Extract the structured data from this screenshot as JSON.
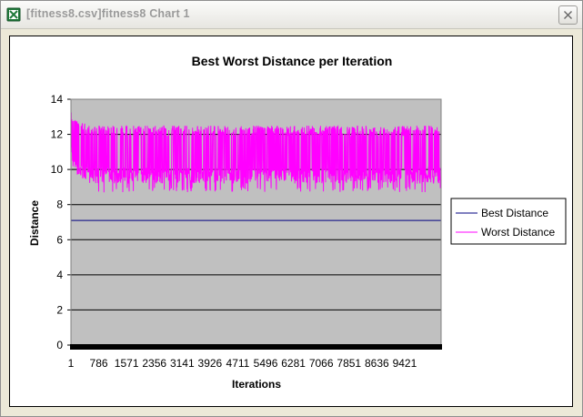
{
  "window": {
    "title": "[fitness8.csv]fitness8 Chart 1",
    "app_icon": "excel-chart-icon",
    "close_icon": "close-icon"
  },
  "chart_data": {
    "type": "line",
    "title": "Best Worst Distance per Iteration",
    "xlabel": "Iterations",
    "ylabel": "Distance",
    "ylim": [
      0,
      14
    ],
    "xlim": [
      1,
      10450
    ],
    "y_ticks": [
      0,
      2,
      4,
      6,
      8,
      10,
      12,
      14
    ],
    "x_tick_labels": [
      "1",
      "786",
      "1571",
      "2356",
      "3141",
      "3926",
      "4711",
      "5496",
      "6281",
      "7066",
      "7851",
      "8636",
      "9421"
    ],
    "grid": true,
    "legend": "right",
    "plot_background": "#c0c0c0",
    "series": [
      {
        "name": "Best Distance",
        "color": "#000080",
        "x": [
          1,
          10450
        ],
        "values": [
          7.1,
          7.1
        ]
      },
      {
        "name": "Worst Distance",
        "color": "#ff00ff",
        "band": true,
        "x": [
          1,
          50,
          100,
          200,
          300,
          400,
          500,
          700,
          1000,
          2000,
          4000,
          6000,
          8000,
          10450
        ],
        "max": [
          13.4,
          13.2,
          13.0,
          12.8,
          12.7,
          12.6,
          12.5,
          12.5,
          12.5,
          12.5,
          12.5,
          12.5,
          12.5,
          12.5
        ],
        "min": [
          11.0,
          10.2,
          9.9,
          9.6,
          9.4,
          9.3,
          9.2,
          9.2,
          9.2,
          9.2,
          9.2,
          9.2,
          9.2,
          9.2
        ],
        "spike_low": 8.7,
        "typical_range": [
          9.6,
          12.2
        ]
      }
    ]
  }
}
